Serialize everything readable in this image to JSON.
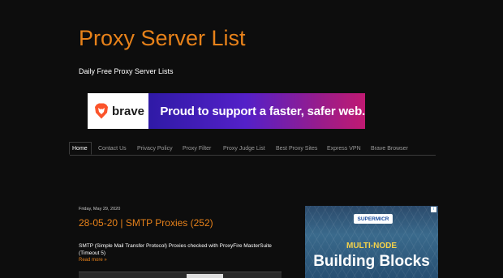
{
  "header": {
    "title": "Proxy Server List",
    "description": "Daily Free Proxy Server Lists"
  },
  "banner": {
    "brand": "brave",
    "tagline": "Proud to support a faster, safer web.",
    "icon": "brave-lion-icon",
    "colors": {
      "gradient_start": "#2f1aa6",
      "gradient_end": "#c01a72",
      "logo": "#fb542b"
    }
  },
  "nav": {
    "items": [
      {
        "label": "Home"
      },
      {
        "label": "Contact Us"
      },
      {
        "label": "Privacy Policy"
      },
      {
        "label": "Proxy Filter"
      },
      {
        "label": "Proxy Judge List"
      },
      {
        "label": "Best Proxy Sites"
      },
      {
        "label": "Express VPN"
      },
      {
        "label": "Brave Browser"
      }
    ],
    "active": "Home"
  },
  "post": {
    "date": "Friday, May 29, 2020",
    "title": "28-05-20 | SMTP Proxies (252)",
    "body": "SMTP (Simple Mail Transfer Protocol) Proxies checked with ProxyFire MasterSuite (Timeout 5)",
    "read_more": "Read more »"
  },
  "ad": {
    "logo": "SUPERMICR",
    "line1": "MULTI-NODE",
    "line2": "Building Blocks",
    "info_icon": "ad-info-icon"
  },
  "colors": {
    "accent": "#e8821a",
    "background": "#0d0d0d",
    "text": "#ffffff",
    "nav_text": "#9a9a9a"
  }
}
